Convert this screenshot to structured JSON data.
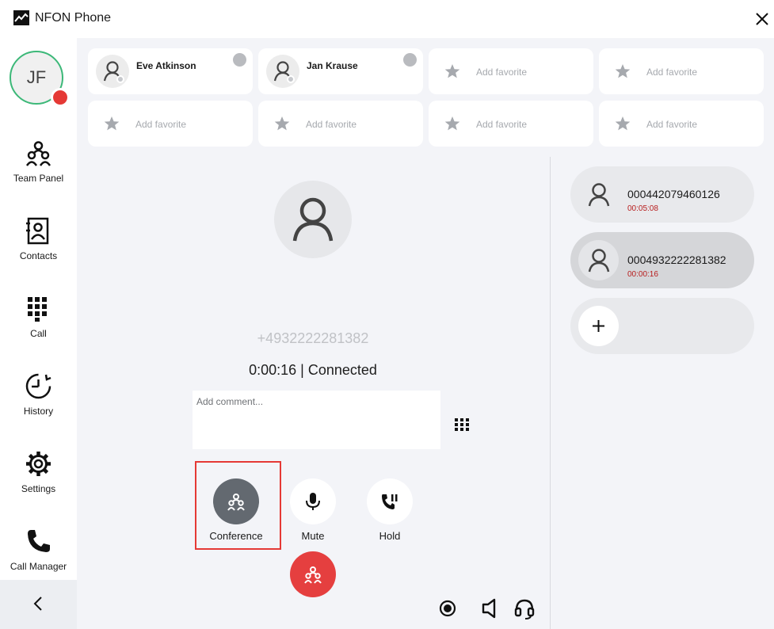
{
  "app": {
    "title": "NFON Phone"
  },
  "user": {
    "initials": "JF"
  },
  "nav": [
    {
      "id": "team-panel",
      "label": "Team Panel"
    },
    {
      "id": "contacts",
      "label": "Contacts"
    },
    {
      "id": "call",
      "label": "Call"
    },
    {
      "id": "history",
      "label": "History"
    },
    {
      "id": "settings",
      "label": "Settings"
    },
    {
      "id": "call-manager",
      "label": "Call Manager"
    }
  ],
  "favorites": {
    "contacts": [
      {
        "name": "Eve Atkinson"
      },
      {
        "name": "Jan Krause"
      }
    ],
    "add_label": "Add favorite"
  },
  "call": {
    "number": "+4932222281382",
    "status": "0:00:16 | Connected",
    "comment_placeholder": "Add comment..."
  },
  "actions": {
    "conference": "Conference",
    "mute": "Mute",
    "hold": "Hold"
  },
  "calls": [
    {
      "number": "000442079460126",
      "duration": "00:05:08"
    },
    {
      "number": "0004932222281382",
      "duration": "00:00:16"
    }
  ],
  "colors": {
    "accent_red": "#e53935",
    "online_green": "#3cb878",
    "duration_red": "#b71c1c"
  }
}
